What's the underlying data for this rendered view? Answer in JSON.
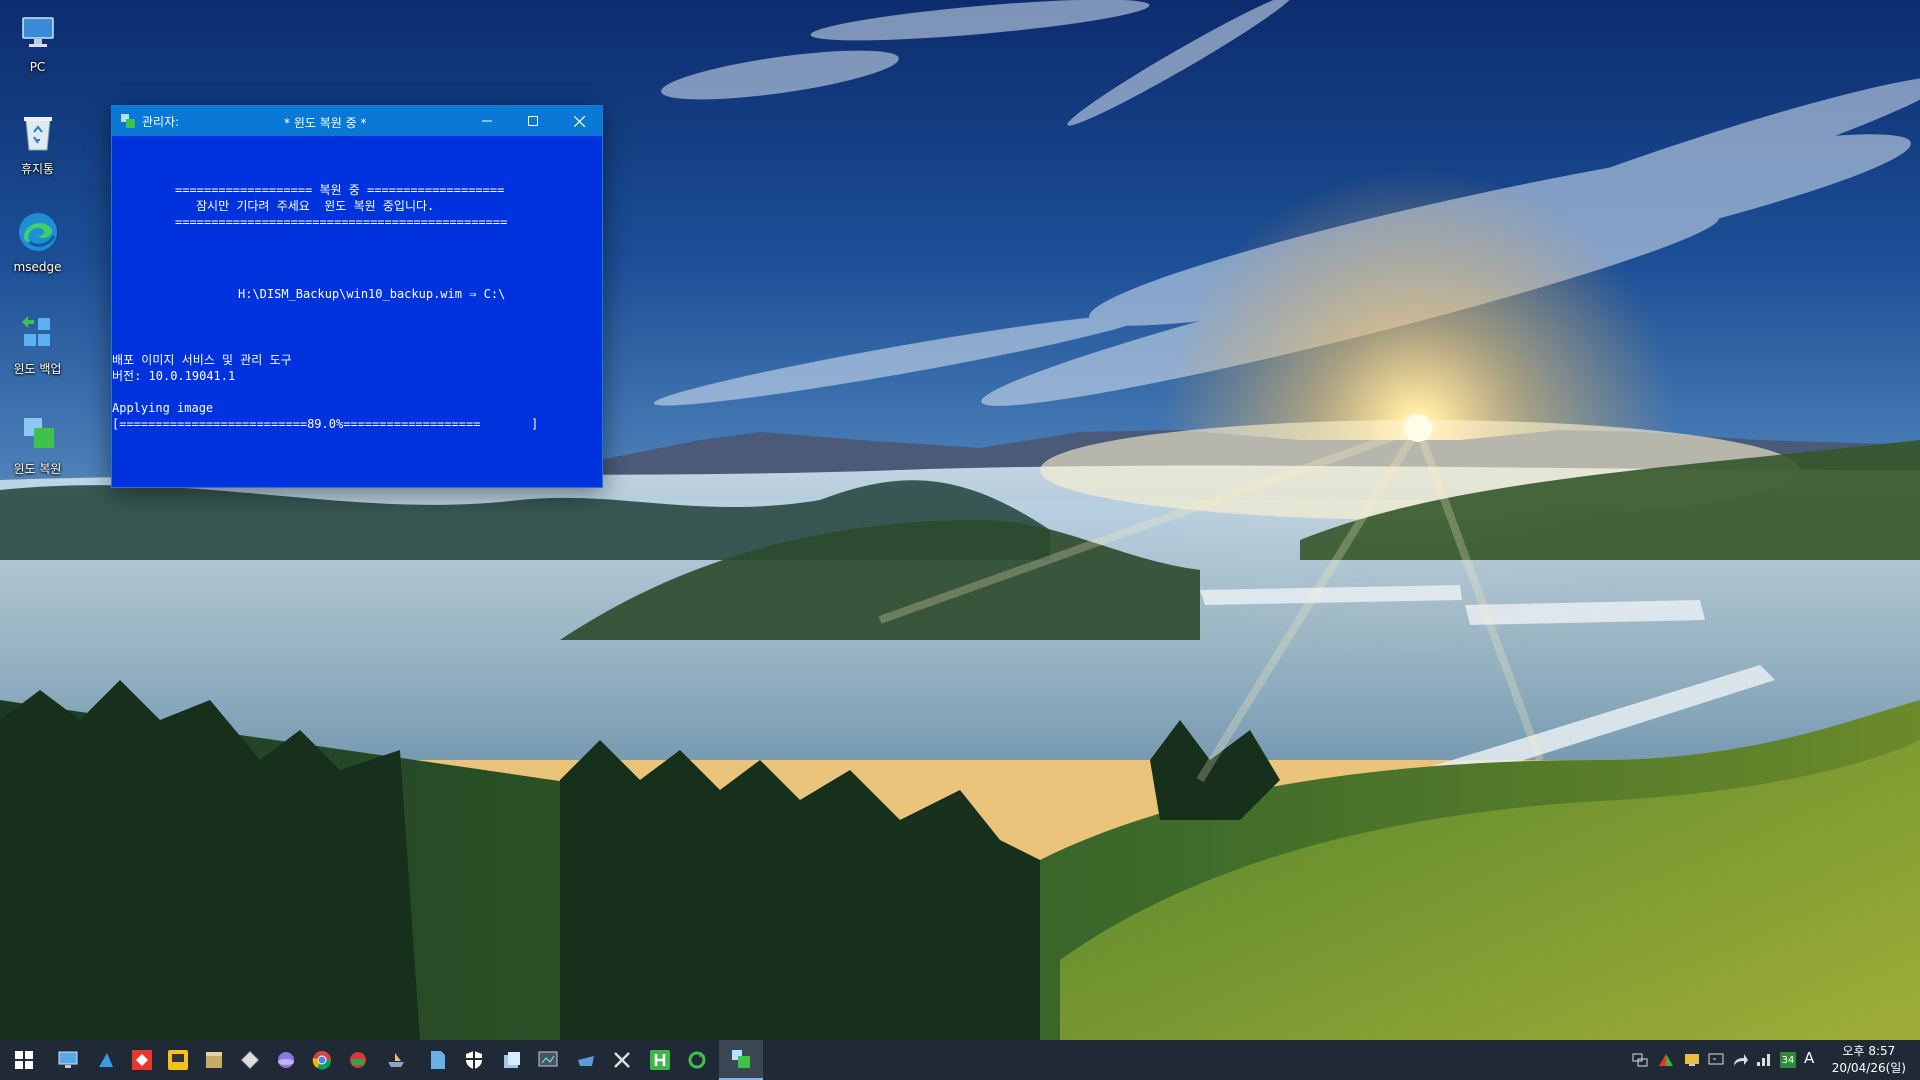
{
  "desktop": {
    "icons": [
      {
        "label": "PC",
        "icon": "pc-icon"
      },
      {
        "label": "휴지통",
        "icon": "recycle-bin-icon"
      },
      {
        "label": "msedge",
        "icon": "edge-icon"
      },
      {
        "label": "윈도 백업",
        "icon": "windows-backup-icon"
      },
      {
        "label": "윈도 복원",
        "icon": "windows-restore-icon"
      }
    ]
  },
  "console": {
    "title_prefix": "관리자:",
    "title": "* 윈도 복원 중 *",
    "lines": {
      "banner_top": "=================== 복원 중 ===================",
      "banner_msg": "잠시만 기다려 주세요  윈도 복원 중입니다.",
      "banner_bottom": "==============================================",
      "path": "H:\\DISM_Backup\\win10_backup.wim ⇒ C:\\",
      "tool_name": "배포 이미지 서비스 및 관리 도구",
      "version": "버전: 10.0.19041.1",
      "status": "Applying image",
      "progress_bar": "[==========================89.0%===================       ]"
    },
    "progress_percent": 89.0,
    "colors": {
      "background": "#0033dd",
      "titlebar": "#0a78d7",
      "text": "#ffffff"
    }
  },
  "taskbar": {
    "pinned": [
      "start-icon",
      "desktop-icon",
      "arrow-app-icon",
      "anydesk-icon",
      "potplayer-icon",
      "archive-icon",
      "diamond-icon",
      "ball-icon",
      "chrome-icon",
      "game-icon",
      "boat-icon",
      "file-icon",
      "shield-icon",
      "explorer-icon",
      "display-icon",
      "ship-icon",
      "tools-icon",
      "h-icon",
      "refresh-icon",
      "active-console-icon"
    ],
    "tray": {
      "badge": "34",
      "ime": "A"
    },
    "clock": {
      "time": "오후 8:57",
      "date": "20/04/26(일)"
    }
  }
}
